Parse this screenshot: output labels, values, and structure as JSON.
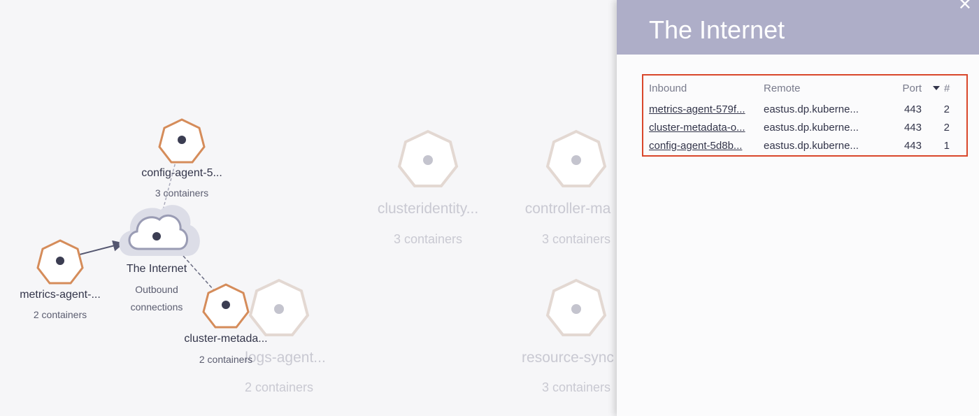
{
  "graph": {
    "nodes": [
      {
        "id": "config",
        "name": "config-agent-5...",
        "sub": "3 containers"
      },
      {
        "id": "internet",
        "name": "The Internet",
        "sub_line1": "Outbound",
        "sub_line2": "connections"
      },
      {
        "id": "metrics",
        "name": "metrics-agent-...",
        "sub": "2 containers"
      },
      {
        "id": "clustermeta",
        "name": "cluster-metada...",
        "sub": "2 containers"
      }
    ],
    "faded_nodes": [
      {
        "id": "clusteridentity",
        "name": "clusteridentity...",
        "sub": "3 containers"
      },
      {
        "id": "controller",
        "name": "controller-ma",
        "sub": "3 containers"
      },
      {
        "id": "logs",
        "name": "logs-agent...",
        "sub": "2 containers"
      },
      {
        "id": "resource",
        "name": "resource-sync",
        "sub": "3 containers"
      }
    ],
    "colors": {
      "active_node": "#d58c5a",
      "faded_node": "#e1d6d0",
      "edge": "#555770",
      "cloud_halo": "#dcdde7"
    }
  },
  "panel": {
    "title": "The Internet",
    "close_icon": "close-icon",
    "columns": {
      "inbound": "Inbound",
      "remote": "Remote",
      "port": "Port",
      "count": "#"
    },
    "rows": [
      {
        "inbound": "metrics-agent-579f...",
        "remote": "eastus.dp.kuberne...",
        "port": "443",
        "count": "2"
      },
      {
        "inbound": "cluster-metadata-o...",
        "remote": "eastus.dp.kuberne...",
        "port": "443",
        "count": "2"
      },
      {
        "inbound": "config-agent-5d8b...",
        "remote": "eastus.dp.kuberne...",
        "port": "443",
        "count": "1"
      }
    ]
  }
}
